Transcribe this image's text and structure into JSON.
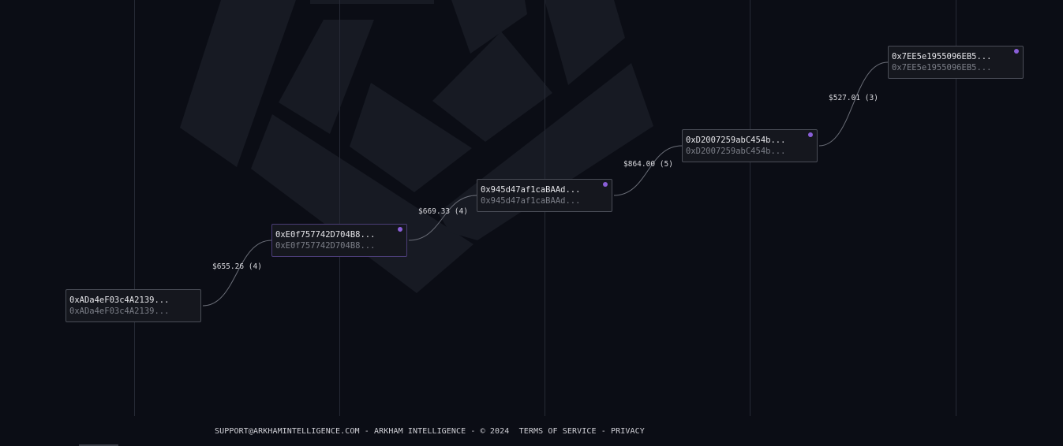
{
  "graph": {
    "nodes": [
      {
        "id": "n1",
        "label": "0xADa4eF03c4A2139...",
        "sublabel": "0xADa4eF03c4A2139...",
        "highlighted": false
      },
      {
        "id": "n2",
        "label": "0xE0f757742D704B8...",
        "sublabel": "0xE0f757742D704B8...",
        "highlighted": true
      },
      {
        "id": "n3",
        "label": "0x945d47af1caBAAd...",
        "sublabel": "0x945d47af1caBAAd...",
        "highlighted": false
      },
      {
        "id": "n4",
        "label": "0xD2007259abC454b...",
        "sublabel": "0xD2007259abC454b...",
        "highlighted": false
      },
      {
        "id": "n5",
        "label": "0x7EE5e1955096EB5...",
        "sublabel": "0x7EE5e1955096EB5...",
        "highlighted": false
      }
    ],
    "edges": [
      {
        "from": "n1",
        "to": "n2",
        "label": "$655.26 (4)"
      },
      {
        "from": "n2",
        "to": "n3",
        "label": "$669.33 (4)"
      },
      {
        "from": "n3",
        "to": "n4",
        "label": "$864.00 (5)"
      },
      {
        "from": "n4",
        "to": "n5",
        "label": "$527.01 (3)"
      }
    ]
  },
  "footer": {
    "support_email": "SUPPORT@ARKHAMINTELLIGENCE.COM",
    "separator": "-",
    "company": "ARKHAM INTELLIGENCE",
    "copyright": "© 2024",
    "terms": "TERMS OF SERVICE",
    "privacy": "PRIVACY"
  },
  "colors": {
    "background": "#0b0d15",
    "node_border": "#4a4d57",
    "node_highlight_border": "#4b3d77",
    "accent_dot": "#8a5fd8",
    "edge": "#6b6e78"
  }
}
